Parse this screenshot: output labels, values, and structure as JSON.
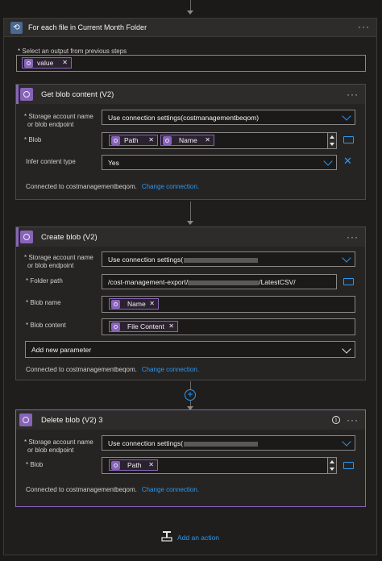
{
  "loop": {
    "title": "For each file in Current Month Folder",
    "select_label": "* Select an output from previous steps",
    "token_value": "value",
    "more": "···",
    "loop_icon": "loop-icon"
  },
  "get_blob": {
    "title": "Get blob content (V2)",
    "storage_label_1": "* Storage account name",
    "storage_label_2": "or blob endpoint",
    "storage_value": "Use connection settings(costmanagementbeqom)",
    "blob_label": "* Blob",
    "token_path": "Path",
    "token_name": "Name",
    "infer_label": "Infer content type",
    "infer_value": "Yes",
    "connected": "Connected to costmanagementbeqom.",
    "change": "Change connection.",
    "more": "···"
  },
  "create_blob": {
    "title": "Create blob (V2)",
    "storage_label_1": "* Storage account name",
    "storage_label_2": "or blob endpoint",
    "storage_value": "Use connection settings(",
    "folder_label": "* Folder path",
    "folder_value_a": "/cost-management-export/",
    "folder_value_b": "/LatestCSV/",
    "blobname_label": "* Blob name",
    "token_name": "Name",
    "content_label": "* Blob content",
    "token_content": "File Content",
    "add_param": "Add new parameter",
    "connected": "Connected to costmanagementbeqom.",
    "change": "Change connection.",
    "more": "···"
  },
  "delete_blob": {
    "title": "Delete blob (V2) 3",
    "storage_label_1": "* Storage account name",
    "storage_label_2": "or blob endpoint",
    "storage_value": "Use connection settings(",
    "blob_label": "* Blob",
    "token_path": "Path",
    "connected": "Connected to costmanagementbeqom.",
    "change": "Change connection.",
    "more": "···",
    "info": "i"
  },
  "add_action": "Add an action",
  "colors": {
    "accent": "#8764b8",
    "link": "#2899f5",
    "loop": "#486991"
  }
}
